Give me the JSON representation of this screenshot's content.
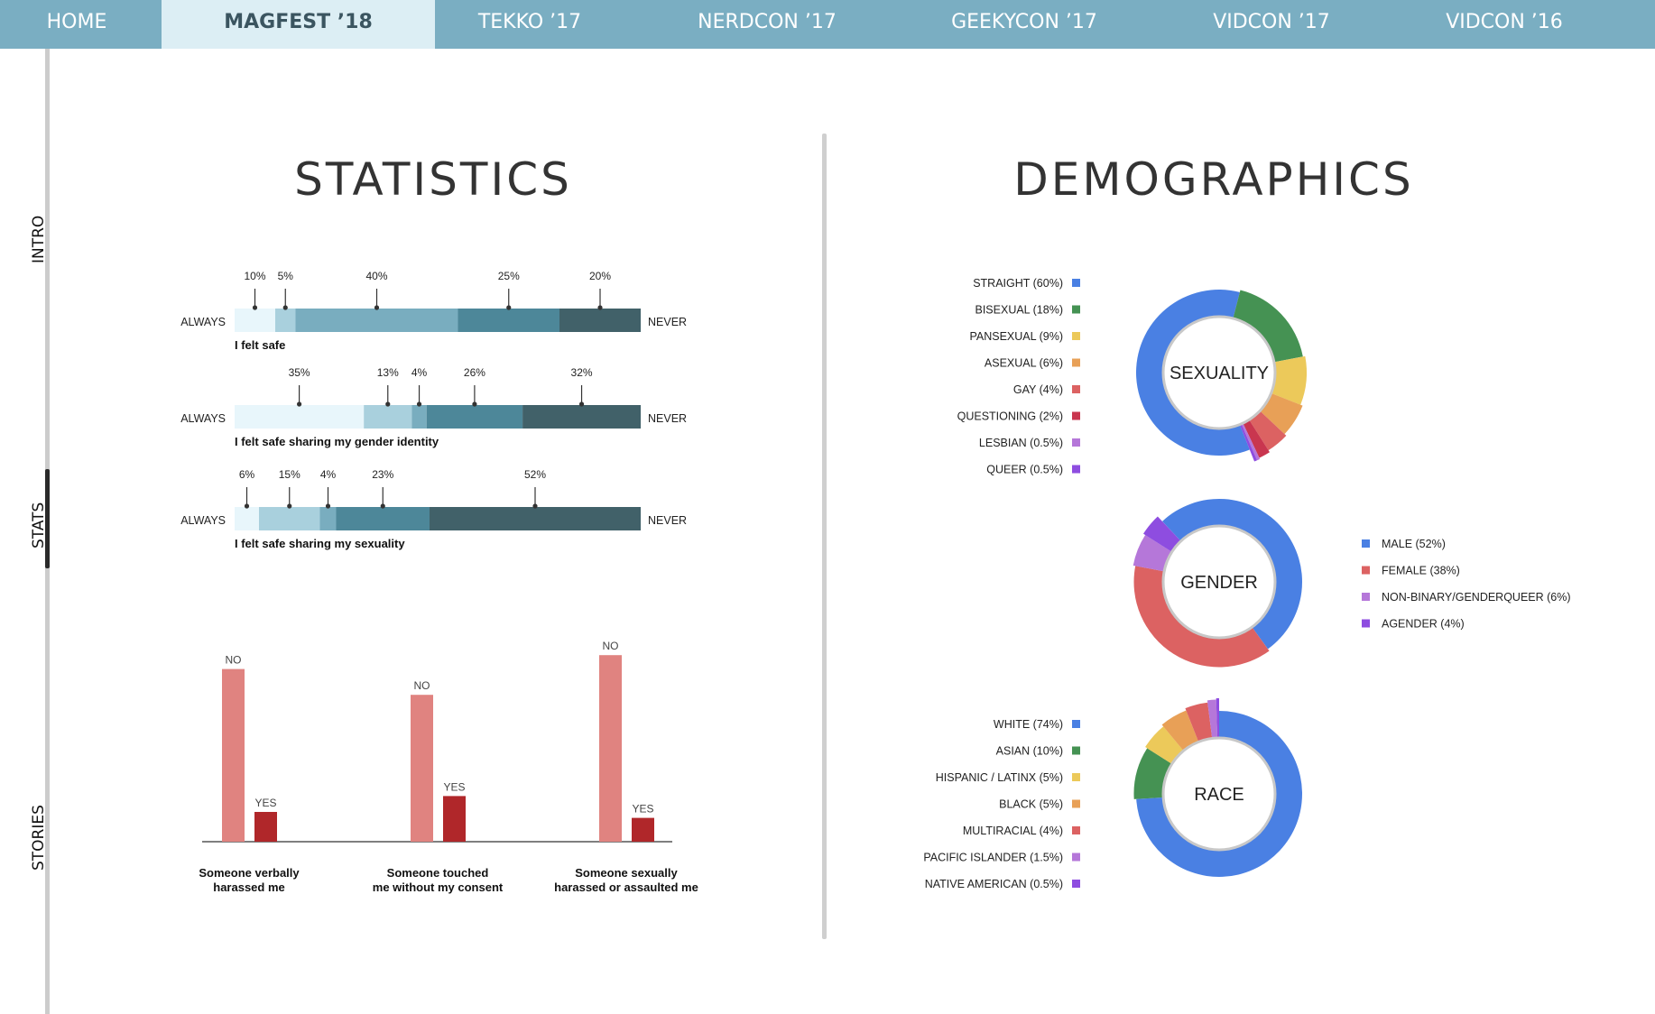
{
  "nav": {
    "tabs": [
      {
        "label": "HOME"
      },
      {
        "label": "MAGFEST ’18"
      },
      {
        "label": "TEKKO ’17"
      },
      {
        "label": "NERDCON ’17"
      },
      {
        "label": "GEEKYCON ’17"
      },
      {
        "label": "VIDCON ’17"
      },
      {
        "label": "VIDCON ’16"
      }
    ],
    "active_index": 1
  },
  "sidebar": {
    "items": [
      {
        "label": "INTRO"
      },
      {
        "label": "STATS"
      },
      {
        "label": "STORIES"
      }
    ],
    "active_index": 1
  },
  "statistics": {
    "title": "STATISTICS"
  },
  "demographics": {
    "title": "DEMOGRAPHICS"
  },
  "colors": {
    "nav": "#7aaec2",
    "nav_active": "#dceef4",
    "scale": [
      "#e8f6fb",
      "#a9d0dd",
      "#79adbf",
      "#4d8799",
      "#416169"
    ],
    "bar_no": "#e08380",
    "bar_yes": "#b0272a"
  },
  "chart_data": [
    {
      "type": "bar",
      "stacked": true,
      "orientation": "horizontal",
      "left_label": "ALWAYS",
      "right_label": "NEVER",
      "categories": [
        "I felt safe",
        "I felt safe sharing my gender identity",
        "I felt safe sharing my sexuality"
      ],
      "series_values": [
        [
          10,
          5,
          40,
          25,
          20
        ],
        [
          35,
          13,
          4,
          26,
          32
        ],
        [
          6,
          15,
          4,
          23,
          52
        ]
      ],
      "unit": "%"
    },
    {
      "type": "bar",
      "categories": [
        "Someone verbally harassed me",
        "Someone touched me without my consent",
        "Someone sexually harassed or assaulted me"
      ],
      "series": [
        {
          "name": "NO",
          "values": [
            87,
            74,
            94
          ]
        },
        {
          "name": "YES",
          "values": [
            15,
            23,
            12
          ]
        }
      ],
      "ylim": [
        0,
        100
      ]
    },
    {
      "type": "pie",
      "title": "SEXUALITY",
      "labels": [
        "STRAIGHT (60%)",
        "BISEXUAL (18%)",
        "PANSEXUAL (9%)",
        "ASEXUAL (6%)",
        "GAY (4%)",
        "QUESTIONING (2%)",
        "LESBIAN (0.5%)",
        "QUEER (0.5%)"
      ],
      "values": [
        60,
        18,
        9,
        6,
        4,
        2,
        0.5,
        0.5
      ],
      "colors": [
        "#4a80e3",
        "#459253",
        "#ecc95a",
        "#e8a057",
        "#dc6262",
        "#c9364f",
        "#b577d9",
        "#8e4de0"
      ],
      "legend": "left"
    },
    {
      "type": "pie",
      "title": "GENDER",
      "labels": [
        "MALE (52%)",
        "FEMALE (38%)",
        "NON-BINARY/GENDERQUEER  (6%)",
        "AGENDER (4%)"
      ],
      "values": [
        52,
        38,
        6,
        4
      ],
      "colors": [
        "#4a80e3",
        "#dc6262",
        "#b577d9",
        "#8e4de0"
      ],
      "legend": "right"
    },
    {
      "type": "pie",
      "title": "RACE",
      "labels": [
        "WHITE (74%)",
        "ASIAN (10%)",
        "HISPANIC / LATINX  (5%)",
        "BLACK (5%)",
        "MULTIRACIAL (4%)",
        "PACIFIC ISLANDER (1.5%)",
        "NATIVE AMERICAN (0.5%)"
      ],
      "values": [
        74,
        10,
        5,
        5,
        4,
        1.5,
        0.5
      ],
      "colors": [
        "#4a80e3",
        "#459253",
        "#ecc95a",
        "#e8a057",
        "#dc6262",
        "#b577d9",
        "#8e4de0"
      ],
      "legend": "left"
    }
  ]
}
